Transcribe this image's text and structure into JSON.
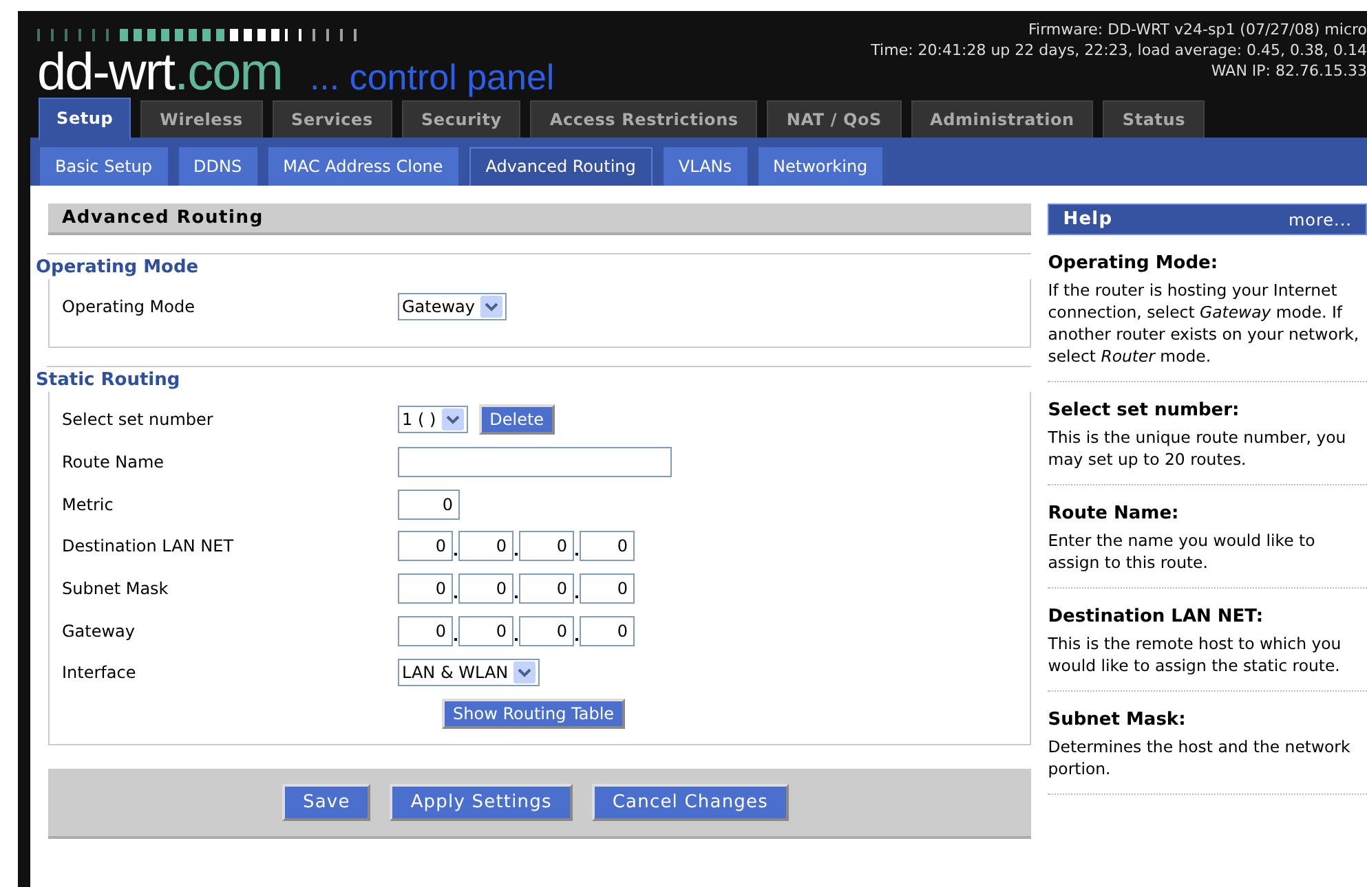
{
  "logo": {
    "brand": "dd-wrt",
    "domain": ".com",
    "tagline": "... control panel"
  },
  "status": [
    "Firmware: DD-WRT v24-sp1 (07/27/08) micro",
    "Time: 20:41:28 up 22 days, 22:23, load average: 0.45, 0.38, 0.14",
    "WAN IP: 82.76.15.33"
  ],
  "tabs": [
    {
      "label": "Setup",
      "selected": true
    },
    {
      "label": "Wireless",
      "selected": false
    },
    {
      "label": "Services",
      "selected": false
    },
    {
      "label": "Security",
      "selected": false
    },
    {
      "label": "Access Restrictions",
      "selected": false
    },
    {
      "label": "NAT / QoS",
      "selected": false
    },
    {
      "label": "Administration",
      "selected": false
    },
    {
      "label": "Status",
      "selected": false
    }
  ],
  "subtabs": [
    {
      "label": "Basic Setup",
      "selected": false
    },
    {
      "label": "DDNS",
      "selected": false
    },
    {
      "label": "MAC Address Clone",
      "selected": false
    },
    {
      "label": "Advanced Routing",
      "selected": true
    },
    {
      "label": "VLANs",
      "selected": false
    },
    {
      "label": "Networking",
      "selected": false
    }
  ],
  "page_title": "Advanced Routing",
  "sections": [
    {
      "title": "Operating Mode",
      "fields": [
        {
          "kind": "select",
          "label": "Operating Mode",
          "value": "Gateway"
        }
      ]
    },
    {
      "title": "Static Routing",
      "fields": [
        {
          "kind": "select",
          "label": "Select set number",
          "value": "1 ( )",
          "button": "Delete"
        },
        {
          "kind": "text",
          "label": "Route Name"
        },
        {
          "kind": "number",
          "label": "Metric",
          "value": "0"
        },
        {
          "kind": "ip",
          "label": "Destination LAN NET",
          "octets": [
            "0",
            "0",
            "0",
            "0"
          ]
        },
        {
          "kind": "ip",
          "label": "Subnet Mask",
          "octets": [
            "0",
            "0",
            "0",
            "0"
          ]
        },
        {
          "kind": "ip",
          "label": "Gateway",
          "octets": [
            "0",
            "0",
            "0",
            "0"
          ]
        },
        {
          "kind": "select",
          "label": "Interface",
          "value": "LAN & WLAN"
        }
      ],
      "button": "Show Routing Table"
    }
  ],
  "actions": [
    "Save",
    "Apply Settings",
    "Cancel Changes"
  ],
  "help": {
    "title": "Help",
    "more": "more...",
    "items": [
      {
        "heading": "Operating Mode:",
        "text": "If the router is hosting your Internet connection, select *Gateway* mode. If another router exists on your network, select *Router* mode."
      },
      {
        "heading": "Select set number:",
        "text": "This is the unique route number, you may set up to 20 routes."
      },
      {
        "heading": "Route Name:",
        "text": "Enter the name you would like to assign to this route."
      },
      {
        "heading": "Destination LAN NET:",
        "text": "This is the remote host to which you would like to assign the static route."
      },
      {
        "heading": "Subnet Mask:",
        "text": "Determines the host and the network portion."
      }
    ]
  }
}
